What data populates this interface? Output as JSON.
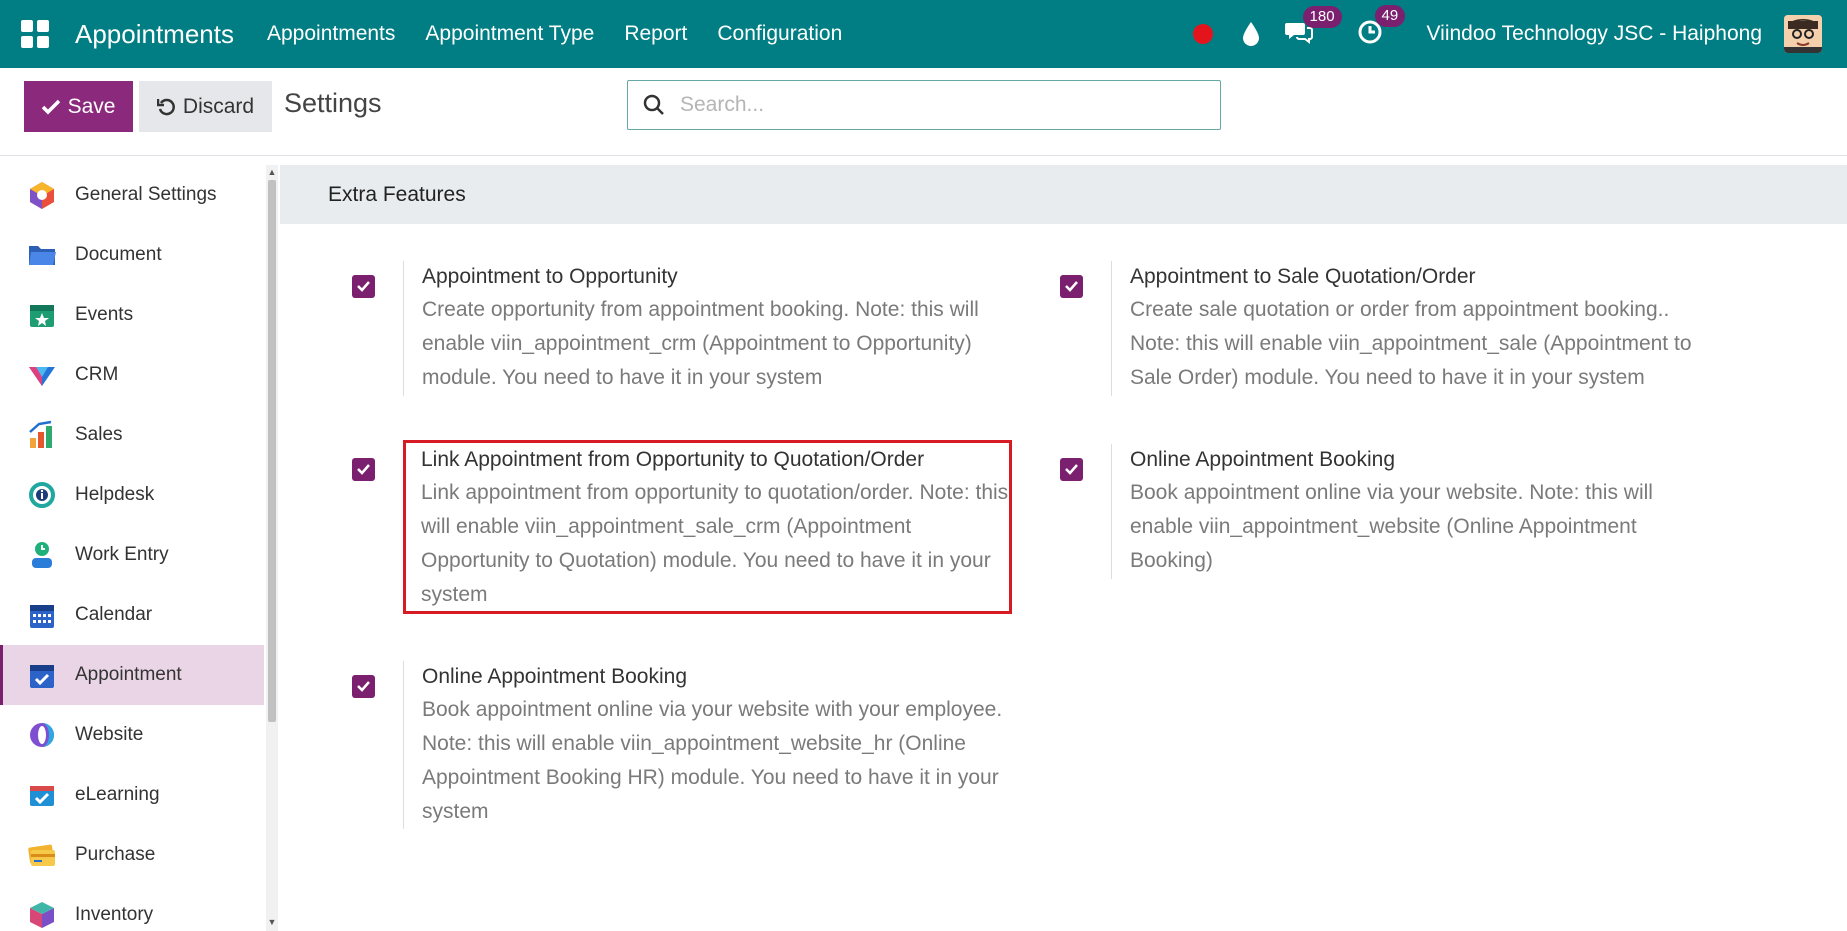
{
  "navbar": {
    "app_title": "Appointments",
    "menu": [
      "Appointments",
      "Appointment Type",
      "Report",
      "Configuration"
    ],
    "messages_count": "180",
    "activities_count": "49",
    "company": "Viindoo Technology JSC - Haiphong"
  },
  "control": {
    "save_label": "Save",
    "discard_label": "Discard",
    "page_title": "Settings",
    "search_placeholder": "Search..."
  },
  "sidebar": {
    "items": [
      {
        "label": "General Settings",
        "icon": "general-settings-icon"
      },
      {
        "label": "Document",
        "icon": "folder-icon"
      },
      {
        "label": "Events",
        "icon": "events-icon"
      },
      {
        "label": "CRM",
        "icon": "crm-icon"
      },
      {
        "label": "Sales",
        "icon": "sales-icon"
      },
      {
        "label": "Helpdesk",
        "icon": "helpdesk-icon"
      },
      {
        "label": "Work Entry",
        "icon": "work-entry-icon"
      },
      {
        "label": "Calendar",
        "icon": "calendar-icon"
      },
      {
        "label": "Appointment",
        "icon": "appointment-icon"
      },
      {
        "label": "Website",
        "icon": "website-icon"
      },
      {
        "label": "eLearning",
        "icon": "elearning-icon"
      },
      {
        "label": "Purchase",
        "icon": "purchase-icon"
      },
      {
        "label": "Inventory",
        "icon": "inventory-icon"
      }
    ],
    "active": "Appointment"
  },
  "main": {
    "section_title": "Extra Features",
    "settings": [
      {
        "title": "Appointment to Opportunity",
        "desc": "Create opportunity from appointment booking. Note: this will enable viin_appointment_crm (Appointment to Opportunity) module. You need to have it in your system",
        "checked": true
      },
      {
        "title": "Appointment to Sale Quotation/Order",
        "desc": "Create sale quotation or order from appointment booking.. Note: this will enable viin_appointment_sale (Appointment to Sale Order) module. You need to have it in your system",
        "checked": true
      },
      {
        "title": "Link Appointment from Opportunity to Quotation/Order",
        "desc": "Link appointment from opportunity to quotation/order. Note: this will enable viin_appointment_sale_crm (Appointment Opportunity to Quotation) module. You need to have it in your system",
        "checked": true
      },
      {
        "title": "Online Appointment Booking",
        "desc": "Book appointment online via your website. Note: this will enable viin_appointment_website (Online Appointment Booking)",
        "checked": true
      },
      {
        "title": "Online Appointment Booking",
        "desc": "Book appointment online via your website with your employee. Note: this will enable viin_appointment_website_hr (Online Appointment Booking HR) module. You need to have it in your system",
        "checked": true
      }
    ]
  },
  "colors": {
    "navbar": "#017e84",
    "primary": "#8b2a7d",
    "checkbox": "#7b1f6f",
    "highlight": "#d61b24"
  }
}
